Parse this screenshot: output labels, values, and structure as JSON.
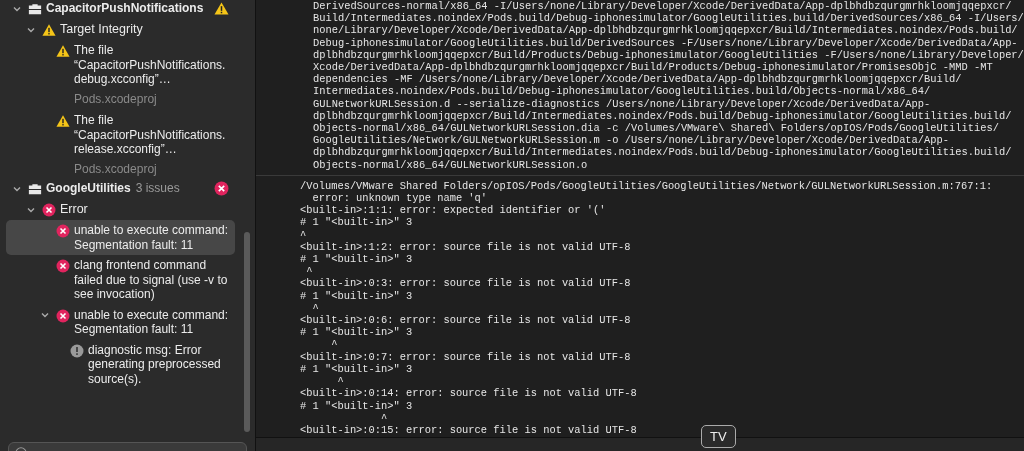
{
  "navigator": {
    "groups": [
      {
        "name": "CapacitorPushNotifications",
        "expanded": true,
        "kind": "warning",
        "category": {
          "kind": "warning",
          "label": "Target Integrity",
          "expanded": true,
          "issues": [
            {
              "kind": "warning",
              "label": "The file “CapacitorPushNotifications.debug.xcconfig”…",
              "detail": "Pods.xcodeproj",
              "selected": false
            },
            {
              "kind": "warning",
              "label": "The file “CapacitorPushNotifications.release.xcconfig”…",
              "detail": "Pods.xcodeproj",
              "selected": false
            }
          ]
        }
      },
      {
        "name": "GoogleUtilities",
        "count": "3 issues",
        "expanded": true,
        "kind": "error",
        "category": {
          "kind": "error",
          "label": "Error",
          "expanded": true,
          "issues": [
            {
              "kind": "error",
              "label": "unable to execute command: Segmentation fault: 11",
              "selected": true
            },
            {
              "kind": "error",
              "label": "clang frontend command failed due to signal (use -v to see invocation)",
              "selected": false
            },
            {
              "kind": "error",
              "label": "unable to execute command: Segmentation fault: 11",
              "selected": false,
              "expanded": true,
              "notes": [
                {
                  "kind": "note",
                  "label": "diagnostic msg: Error generating preprocessed source(s).",
                  "selected": false
                }
              ]
            }
          ]
        }
      }
    ]
  },
  "log": {
    "command_lines": [
      "DerivedSources-normal/x86_64 -I/Users/none/Library/Developer/Xcode/DerivedData/App-dplbhdbzqurgmrhkloomjqqepxcr/",
      "Build/Intermediates.noindex/Pods.build/Debug-iphonesimulator/GoogleUtilities.build/DerivedSources/x86_64 -I/Users/",
      "none/Library/Developer/Xcode/DerivedData/App-dplbhdbzqurgmrhkloomjqqepxcr/Build/Intermediates.noindex/Pods.build/",
      "Debug-iphonesimulator/GoogleUtilities.build/DerivedSources -F/Users/none/Library/Developer/Xcode/DerivedData/App-",
      "dplbhdbzqurgmrhkloomjqqepxcr/Build/Products/Debug-iphonesimulator/GoogleUtilities -F/Users/none/Library/Developer/",
      "Xcode/DerivedData/App-dplbhdbzqurgmrhkloomjqqepxcr/Build/Products/Debug-iphonesimulator/PromisesObjC -MMD -MT",
      "dependencies -MF /Users/none/Library/Developer/Xcode/DerivedData/App-dplbhdbzqurgmrhkloomjqqepxcr/Build/",
      "Intermediates.noindex/Pods.build/Debug-iphonesimulator/GoogleUtilities.build/Objects-normal/x86_64/",
      "GULNetworkURLSession.d --serialize-diagnostics /Users/none/Library/Developer/Xcode/DerivedData/App-",
      "dplbhdbzqurgmrhkloomjqqepxcr/Build/Intermediates.noindex/Pods.build/Debug-iphonesimulator/GoogleUtilities.build/",
      "Objects-normal/x86_64/GULNetworkURLSession.dia -c /Volumes/VMware\\ Shared\\ Folders/opIOS/Pods/GoogleUtilities/",
      "GoogleUtilities/Network/GULNetworkURLSession.m -o /Users/none/Library/Developer/Xcode/DerivedData/App-",
      "dplbhdbzqurgmrhkloomjqqepxcr/Build/Intermediates.noindex/Pods.build/Debug-iphonesimulator/GoogleUtilities.build/",
      "Objects-normal/x86_64/GULNetworkURLSession.o"
    ],
    "output_lines": [
      "/Volumes/VMware Shared Folders/opIOS/Pods/GoogleUtilities/GoogleUtilities/Network/GULNetworkURLSession.m:767:1:",
      "  error: unknown type name 'q'",
      "<built-in>:1:1: error: expected identifier or '('",
      "# 1 \"<built-in>\" 3",
      "^",
      "<built-in>:1:2: error: source file is not valid UTF-8",
      "# 1 \"<built-in>\" 3",
      " ^",
      "<built-in>:0:3: error: source file is not valid UTF-8",
      "# 1 \"<built-in>\" 3",
      "  ^",
      "<built-in>:0:6: error: source file is not valid UTF-8",
      "# 1 \"<built-in>\" 3",
      "     ^",
      "<built-in>:0:7: error: source file is not valid UTF-8",
      "# 1 \"<built-in>\" 3",
      "      ^",
      "<built-in>:0:14: error: source file is not valid UTF-8",
      "# 1 \"<built-in>\" 3",
      "             ^",
      "<built-in>:0:15: error: source file is not valid UTF-8"
    ]
  },
  "tooltip": {
    "text": "TV"
  }
}
